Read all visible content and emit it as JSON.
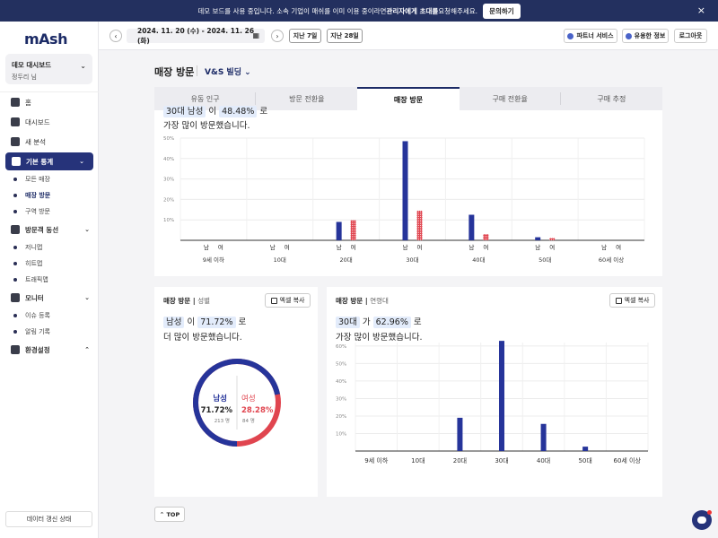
{
  "banner": {
    "text_prefix": "데모 보드를 사용 중입니다. 소속 기업이 매쉬를 이미 이용 중이라면 ",
    "text_bold": "관리자에게 초대를",
    "text_suffix": " 요청해주세요.",
    "button": "문의하기",
    "close_icon": "×"
  },
  "sidebar": {
    "logo": "mAsh",
    "dashboard_title": "데모 대시보드",
    "dashboard_user": "정두리 님",
    "items": [
      {
        "label": "홈",
        "icon": "home-icon"
      },
      {
        "label": "대시보드",
        "icon": "dashboard-icon"
      },
      {
        "label": "새 분석",
        "icon": "search-icon"
      },
      {
        "label": "기본 통계",
        "icon": "chart-icon"
      },
      {
        "label": "모든 매장"
      },
      {
        "label": "매장 방문"
      },
      {
        "label": "구역 방문"
      },
      {
        "label": "방문객 동선",
        "icon": "route-icon"
      },
      {
        "label": "저니맵"
      },
      {
        "label": "히트맵"
      },
      {
        "label": "트래픽맵"
      },
      {
        "label": "모니터",
        "icon": "bell-icon"
      },
      {
        "label": "이슈 등록"
      },
      {
        "label": "알림 기록"
      },
      {
        "label": "환경설정",
        "icon": "gear-icon"
      }
    ],
    "status_button": "데이터 갱신 상태"
  },
  "topbar": {
    "date_range": "2024. 11. 20 (수) - 2024. 11. 26 (화)",
    "last7": "지난 7일",
    "last28": "지난 28일",
    "partner": "파트너 서비스",
    "info": "유용한 정보",
    "logout": "로그아웃"
  },
  "page": {
    "title": "매장 방문",
    "store": "V&S 빌딩",
    "tabs": [
      "유동 인구",
      "방문 전환율",
      "매장 방문",
      "구매 전환율",
      "구매 추정"
    ]
  },
  "top_card": {
    "hl1": "30대 남성",
    "mid": " 이 ",
    "hl2": "48.48%",
    "end": " 로",
    "line2": "가장 많이 방문했습니다."
  },
  "gender_card": {
    "title": "매장 방문",
    "subtitle": "성별",
    "excel": "엑셀 복사",
    "hl1": "남성",
    "mid": " 이 ",
    "hl2": "71.72%",
    "end": " 로",
    "line2": "더 많이 방문했습니다.",
    "male_label": "남성",
    "male_pct": "71.72%",
    "male_count": "213 명",
    "female_label": "여성",
    "female_pct": "28.28%",
    "female_count": "84 명"
  },
  "age_card": {
    "title": "매장 방문",
    "subtitle": "연령대",
    "excel": "엑셀 복사",
    "hl1": "30대",
    "mid": " 가 ",
    "hl2": "62.96%",
    "end": " 로",
    "line2": "가장 많이 방문했습니다."
  },
  "top_button": "TOP",
  "colors": {
    "male": "#26349a",
    "female": "#e0454f",
    "navy": "#1c2b66"
  },
  "chart_data": [
    {
      "type": "bar",
      "categories": [
        "9세 이하",
        "10대",
        "20대",
        "30대",
        "40대",
        "50대",
        "60세 이상"
      ],
      "sublabels": [
        "남",
        "여"
      ],
      "series": [
        {
          "name": "남",
          "values": [
            0,
            0,
            9,
            48.48,
            12.5,
            1.5,
            0
          ]
        },
        {
          "name": "여",
          "values": [
            0,
            0,
            9.8,
            14.5,
            3,
            1.1,
            0
          ]
        }
      ],
      "yticks": [
        "10%",
        "20%",
        "30%",
        "40%",
        "50%"
      ],
      "ylim": [
        0,
        50
      ]
    },
    {
      "type": "pie",
      "categories": [
        "남성",
        "여성"
      ],
      "values": [
        71.72,
        28.28
      ]
    },
    {
      "type": "bar",
      "categories": [
        "9세 이하",
        "10대",
        "20대",
        "30대",
        "40대",
        "50대",
        "60세 이상"
      ],
      "values": [
        0,
        0,
        19,
        62.96,
        15.5,
        2.5,
        0
      ],
      "yticks": [
        "10%",
        "20%",
        "30%",
        "40%",
        "50%",
        "60%"
      ],
      "ylim": [
        0,
        60
      ]
    }
  ]
}
